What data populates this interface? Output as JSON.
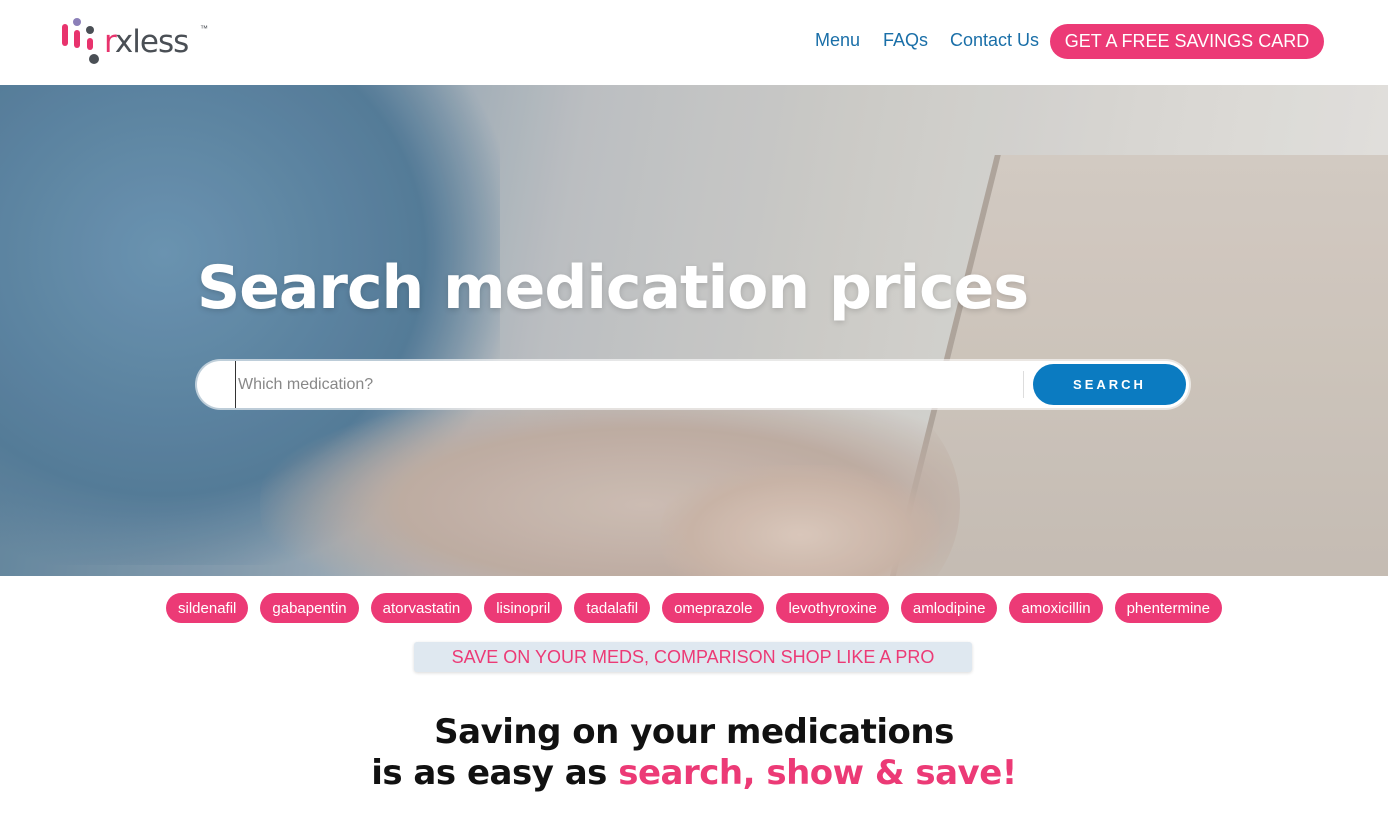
{
  "header": {
    "logo_text_r": "r",
    "logo_text_rest": "xless",
    "logo_tm": "™",
    "nav": [
      "Menu",
      "FAQs",
      "Contact Us"
    ],
    "cta_label": "GET A FREE SAVINGS CARD"
  },
  "hero": {
    "title": "Search medication prices",
    "search_placeholder": "Which medication?",
    "search_button": "SEARCH"
  },
  "popular_meds": [
    "sildenafil",
    "gabapentin",
    "atorvastatin",
    "lisinopril",
    "tadalafil",
    "omeprazole",
    "levothyroxine",
    "amlodipine",
    "amoxicillin",
    "phentermine"
  ],
  "banner": "SAVE ON YOUR MEDS, COMPARISON SHOP LIKE A PRO",
  "tagline": {
    "line1": "Saving on your medications",
    "line2_prefix": "is as easy as ",
    "line2_highlight": "search, show & save!"
  },
  "colors": {
    "brand_pink": "#ec3a76",
    "link_blue": "#1a6fa8",
    "button_blue": "#0b7bc1"
  }
}
